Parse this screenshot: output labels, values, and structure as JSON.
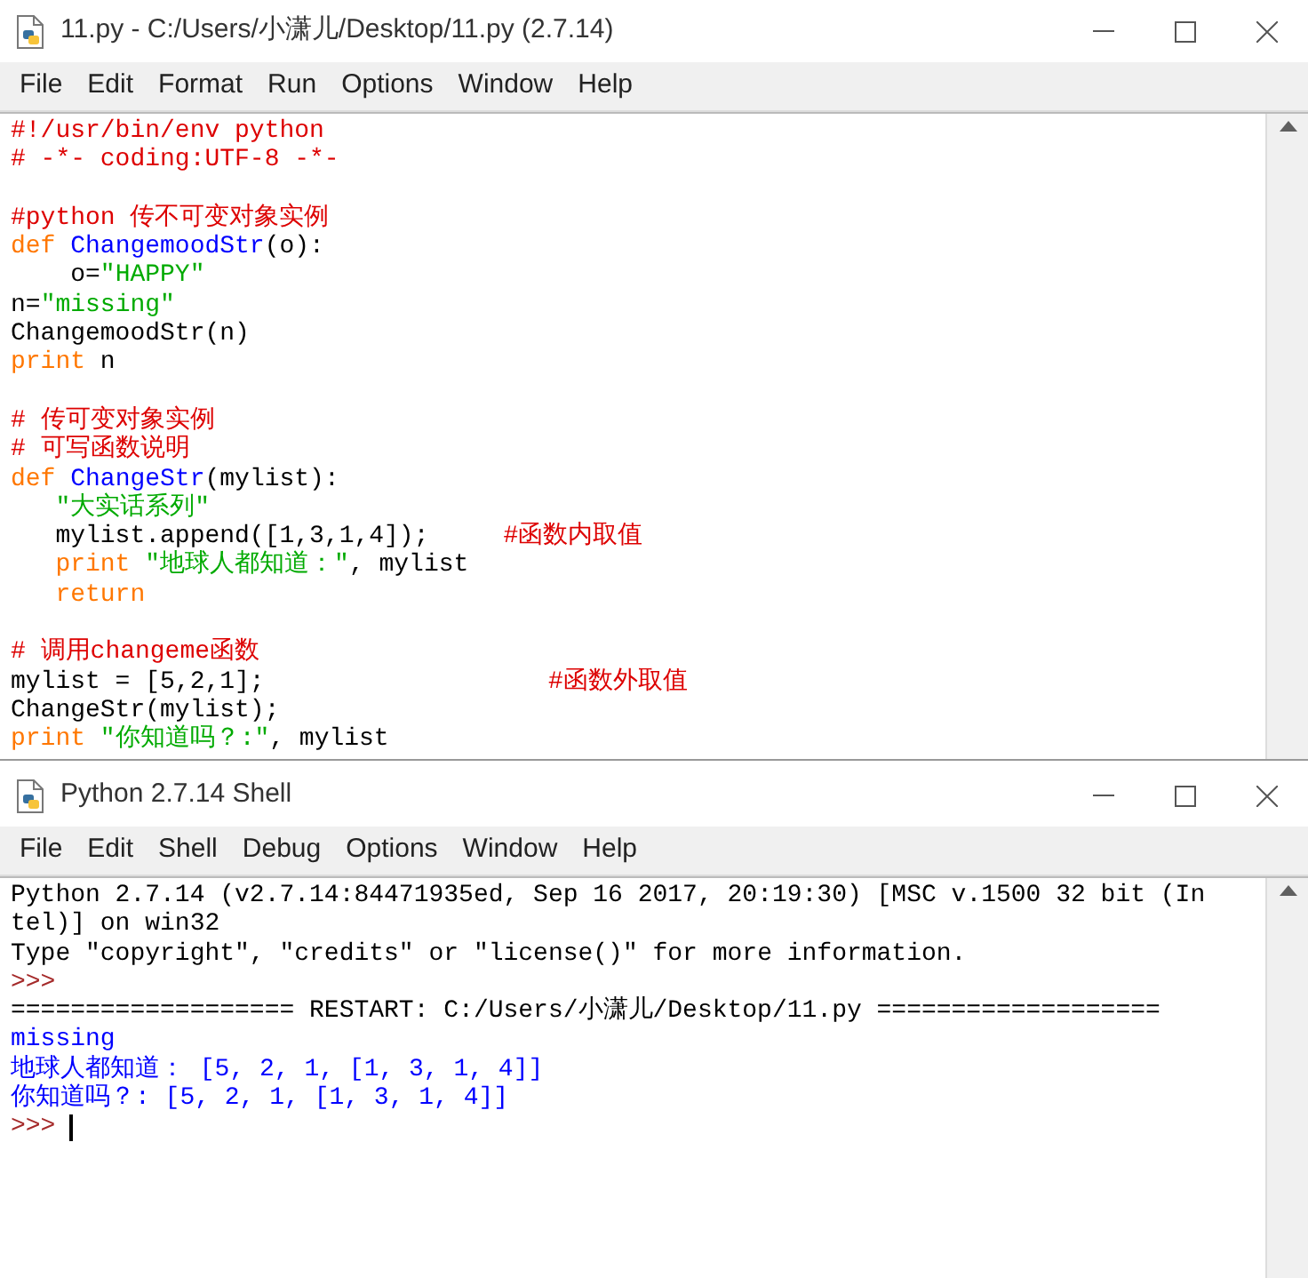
{
  "editor": {
    "title": "11.py - C:/Users/小潇儿/Desktop/11.py (2.7.14)",
    "menu": [
      "File",
      "Edit",
      "Format",
      "Run",
      "Options",
      "Window",
      "Help"
    ],
    "lines": [
      {
        "gap_before": false,
        "tokens": [
          {
            "kind": "comment",
            "text": "#!/usr/bin/env python"
          }
        ]
      },
      {
        "gap_before": false,
        "tokens": [
          {
            "kind": "comment",
            "text": "# -*- coding:UTF-8 -*-"
          }
        ]
      },
      {
        "gap_before": true,
        "tokens": [
          {
            "kind": "comment",
            "text": "#python 传不可变对象实例"
          }
        ]
      },
      {
        "gap_before": false,
        "tokens": [
          {
            "kind": "keyword",
            "text": "def"
          },
          {
            "kind": "defname",
            "text": " ChangemoodStr"
          },
          {
            "kind": "plain",
            "text": "(o):"
          }
        ]
      },
      {
        "gap_before": false,
        "tokens": [
          {
            "kind": "plain",
            "text": "    o="
          },
          {
            "kind": "string",
            "text": "\"HAPPY\""
          }
        ]
      },
      {
        "gap_before": false,
        "tokens": [
          {
            "kind": "plain",
            "text": "n="
          },
          {
            "kind": "string",
            "text": "\"missing\""
          }
        ]
      },
      {
        "gap_before": false,
        "tokens": [
          {
            "kind": "plain",
            "text": "ChangemoodStr(n)"
          }
        ]
      },
      {
        "gap_before": false,
        "tokens": [
          {
            "kind": "keyword",
            "text": "print"
          },
          {
            "kind": "plain",
            "text": " n"
          }
        ]
      },
      {
        "gap_before": true,
        "tokens": [
          {
            "kind": "comment",
            "text": "# 传可变对象实例"
          }
        ]
      },
      {
        "gap_before": false,
        "tokens": [
          {
            "kind": "comment",
            "text": "# 可写函数说明"
          }
        ]
      },
      {
        "gap_before": false,
        "tokens": [
          {
            "kind": "keyword",
            "text": "def"
          },
          {
            "kind": "defname",
            "text": " ChangeStr"
          },
          {
            "kind": "plain",
            "text": "(mylist):"
          }
        ]
      },
      {
        "gap_before": false,
        "tokens": [
          {
            "kind": "string",
            "text": "   \"大实话系列\""
          }
        ]
      },
      {
        "gap_before": false,
        "tokens": [
          {
            "kind": "plain",
            "text": "   mylist.append([1,3,1,4]);"
          },
          {
            "kind": "comment",
            "text": "     #函数内取值"
          }
        ]
      },
      {
        "gap_before": false,
        "tokens": [
          {
            "kind": "keyword",
            "text": "   print"
          },
          {
            "kind": "string",
            "text": " \"地球人都知道：\""
          },
          {
            "kind": "plain",
            "text": ", mylist"
          }
        ]
      },
      {
        "gap_before": false,
        "tokens": [
          {
            "kind": "keyword",
            "text": "   return"
          }
        ]
      },
      {
        "gap_before": true,
        "tokens": [
          {
            "kind": "comment",
            "text": "# 调用changeme函数"
          }
        ]
      },
      {
        "gap_before": false,
        "tokens": [
          {
            "kind": "plain",
            "text": "mylist = [5,2,1];"
          },
          {
            "kind": "comment",
            "text": "                   #函数外取值"
          }
        ]
      },
      {
        "gap_before": false,
        "tokens": [
          {
            "kind": "plain",
            "text": "ChangeStr(mylist);"
          }
        ]
      },
      {
        "gap_before": false,
        "tokens": [
          {
            "kind": "keyword",
            "text": "print"
          },
          {
            "kind": "string",
            "text": " \"你知道吗？:\""
          },
          {
            "kind": "plain",
            "text": ", mylist"
          }
        ]
      }
    ]
  },
  "shell": {
    "title": "Python 2.7.14 Shell",
    "menu": [
      "File",
      "Edit",
      "Shell",
      "Debug",
      "Options",
      "Window",
      "Help"
    ],
    "lines": [
      {
        "kind": "plain",
        "text": "Python 2.7.14 (v2.7.14:84471935ed, Sep 16 2017, 20:19:30) [MSC v.1500 32 bit (In"
      },
      {
        "kind": "plain",
        "text": "tel)] on win32"
      },
      {
        "kind": "plain",
        "text": "Type \"copyright\", \"credits\" or \"license()\" for more information."
      },
      {
        "kind": "prompt",
        "text": ">>>"
      },
      {
        "kind": "plain",
        "text": "=================== RESTART: C:/Users/小潇儿/Desktop/11.py ==================="
      },
      {
        "kind": "output",
        "text": "missing"
      },
      {
        "kind": "output",
        "text": "地球人都知道： [5, 2, 1, [1, 3, 1, 4]]"
      },
      {
        "kind": "output",
        "text": "你知道吗？: [5, 2, 1, [1, 3, 1, 4]]"
      },
      {
        "kind": "prompt",
        "text": ">>>",
        "cursor": true
      }
    ]
  }
}
